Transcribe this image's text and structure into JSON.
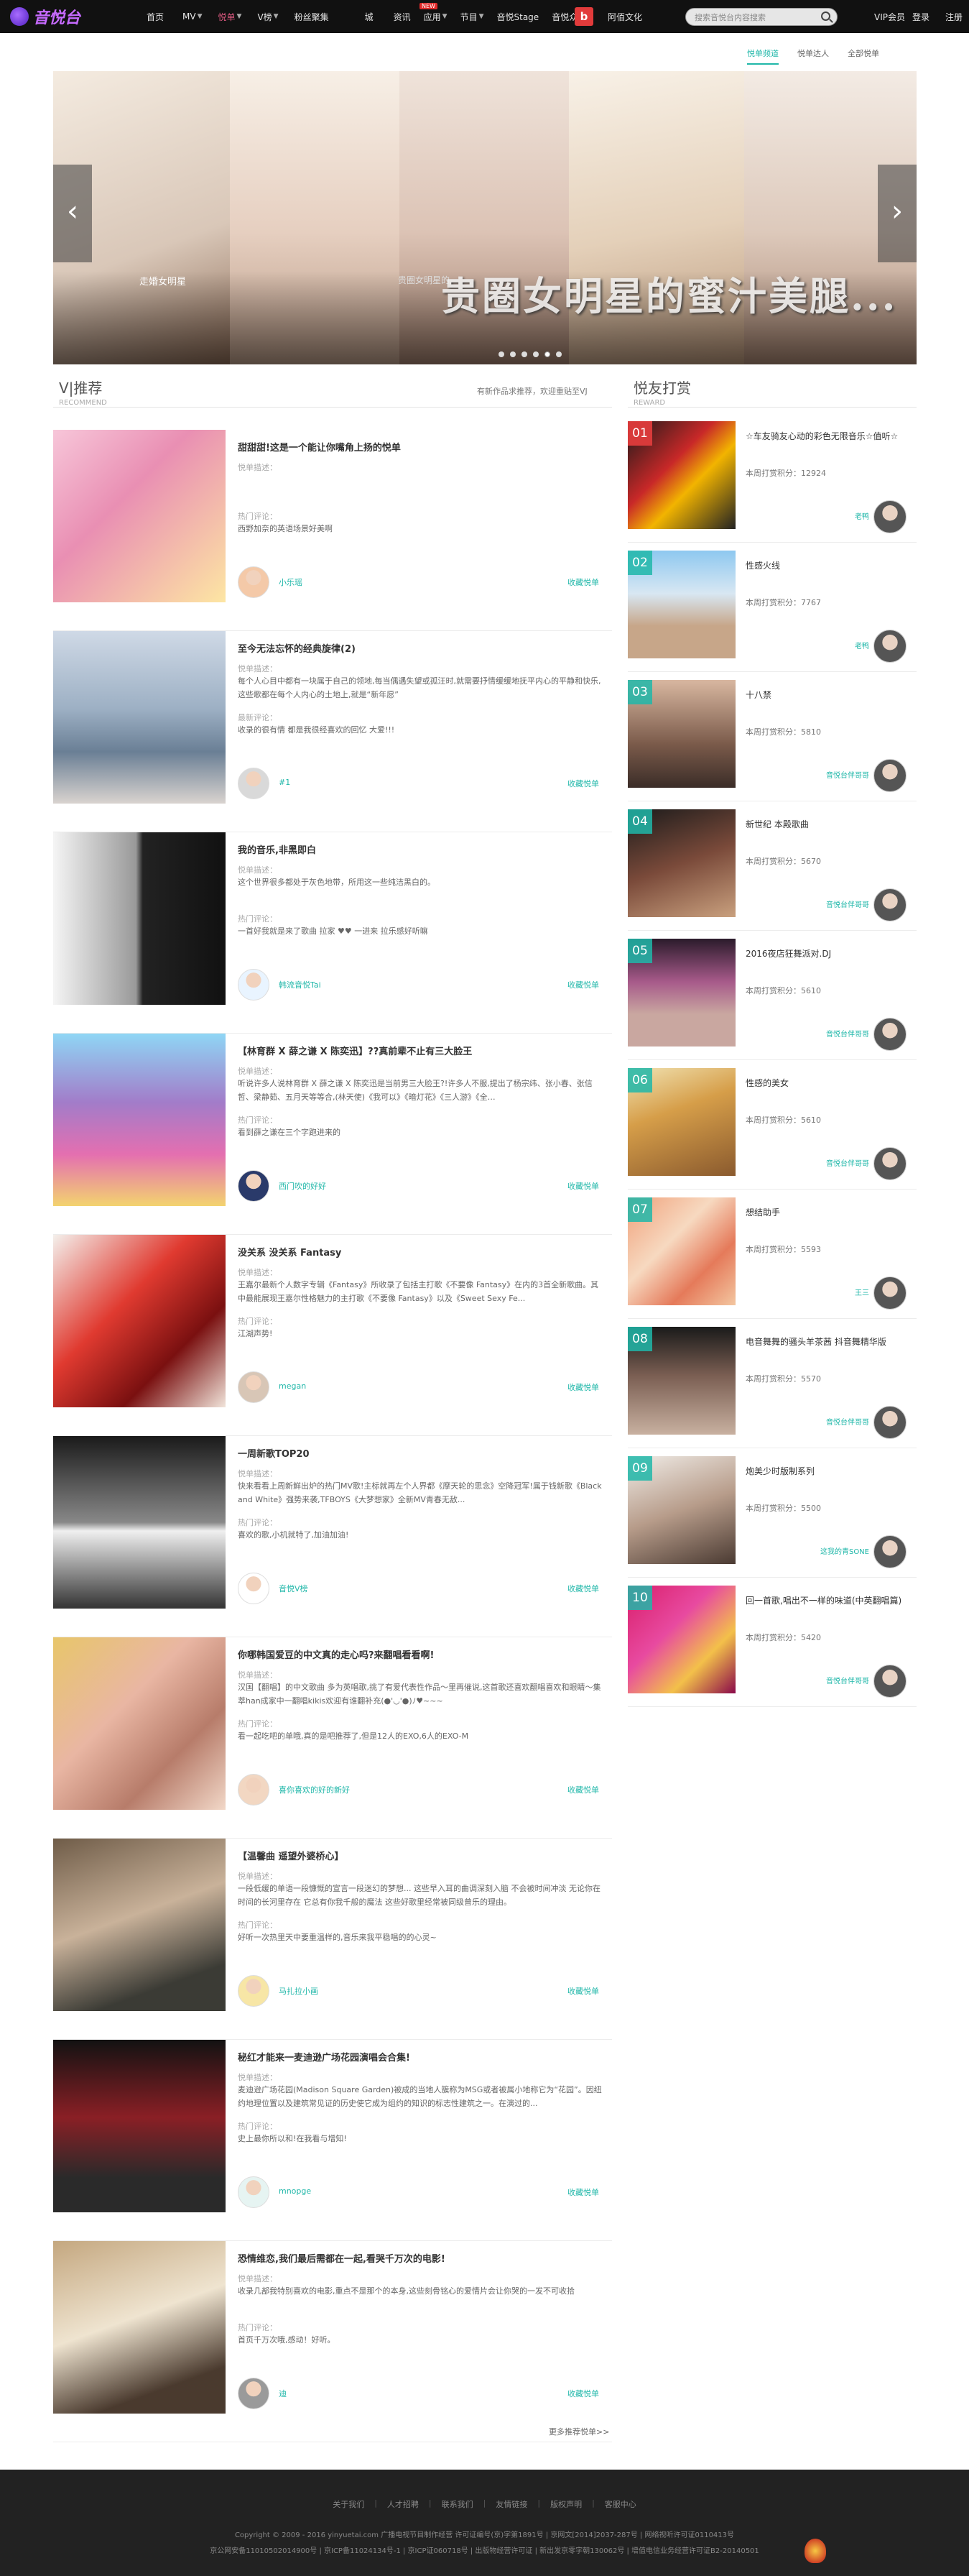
{
  "brand": {
    "logo_text": "音悦台"
  },
  "nav": {
    "items": [
      "首页",
      "MV",
      "悦单",
      "V榜",
      "粉丝聚集",
      "城",
      "资讯",
      "应用",
      "节目",
      "音悦Stage",
      "音悦众筹"
    ],
    "badge": "NEW",
    "bbox_letter": "b",
    "bbox_label": "阿佰文化"
  },
  "search": {
    "placeholder": "搜索音悦台内容搜索"
  },
  "user": {
    "vip": "VIP会员",
    "login": "登录",
    "register": "注册"
  },
  "tabs": [
    {
      "label": "悦单频道"
    },
    {
      "label": "悦单达人"
    },
    {
      "label": "全部悦单"
    }
  ],
  "slider": {
    "caption": "走婚女明星",
    "caption2": "贵圈女明星的",
    "headline": "贵圈女明星的蜜汁美腿..."
  },
  "left_section": {
    "title": "V|推荐",
    "subtitle": "RECOMMEND",
    "hint": "有新作品求推荐，欢迎重贴至VJ"
  },
  "right_section": {
    "title": "悦友打赏",
    "subtitle": "REWARD"
  },
  "cards": [
    {
      "title": "甜甜甜!这是一个能让你嘴角上扬的悦单",
      "desc_label": "悦单描述：",
      "desc": "",
      "hot_label": "热门评论：",
      "hot": "西野加奈的英语场景好美啊",
      "user": "小乐瑶",
      "fav": "收藏悦单"
    },
    {
      "title": "至今无法忘怀的经典旋律(2)",
      "desc_label": "悦单描述：",
      "desc": "每个人心目中都有一块属于自己的领地,每当偶遇失望或孤汪时,就需要抒情缓缓地抚平内心的平静和快乐,这些歌都在每个人内心的土地上,就是“新年愿”",
      "hot_label": "最新评论：",
      "hot": "收录的很有情 都是我很经喜欢的回忆 大爱!!!",
      "user": "#1",
      "fav": "收藏悦单"
    },
    {
      "title": "我的音乐,非黑即白",
      "desc_label": "悦单描述：",
      "desc": "这个世界很多都处于灰色地带，所用这一些纯洁黑白的。",
      "hot_label": "热门评论：",
      "hot": "一首好我就是来了歌曲 拉家 ♥♥ 一进来 拉乐感好听嘛",
      "user": "韩流音悦Tai",
      "fav": "收藏悦单"
    },
    {
      "title": "【林育群 X 薛之谦 X 陈奕迅】??真前辈不止有三大脸王",
      "desc_label": "悦单描述：",
      "desc": "听说许多人说林育群 X 薛之谦 X 陈奕迅是当前男三大脸王?!许多人不服,提出了杨宗纬、张小春、张信哲、梁静茹、五月天等等合,(林天使)《我可以》《暗灯花》《三人游》《全…",
      "hot_label": "热门评论：",
      "hot": "看到薛之谦在三个字跑进来的",
      "user": "西门吹的好好",
      "fav": "收藏悦单"
    },
    {
      "title": "没关系 没关系 Fantasy",
      "desc_label": "悦单描述：",
      "desc": "王嘉尔最新个人数字专辑《Fantasy》所收录了包括主打歌《不要像 Fantasy》在内的3首全新歌曲。其中最能展现王嘉尔性格魅力的主打歌《不要像 Fantasy》以及《Sweet Sexy Fe...",
      "hot_label": "热门评论：",
      "hot": "江湖声势!",
      "user": "megan",
      "fav": "收藏悦单"
    },
    {
      "title": "一周新歌TOP20",
      "desc_label": "悦单描述：",
      "desc": "快来看看上周新鲜出炉的热门MV歌!主标就再左个人界都《摩天轮的思念》空降冠军!属于钱新歌《Black and White》强势来袭,TFBOYS《大梦想家》全新MV青春无敌...",
      "hot_label": "热门评论：",
      "hot": "喜欢的歌,小机就特了,加油加油!",
      "user": "音悦V榜",
      "fav": "收藏悦单"
    },
    {
      "title": "你哪韩国爱豆的中文真的走心吗?来翻唱看看啊!",
      "desc_label": "悦单描述：",
      "desc": "汉国【翻唱】的中文歌曲 多为英唱歌,挑了有爱代表性作品～里再催说,这首歌还喜欢翻唱喜欢和眼睛～集萃han成家中一翻唱kikis欢迎有谁翻补充(●'◡'●)ﾉ♥~~~",
      "hot_label": "热门评论：",
      "hot": "看一起吃吧的单哦,真的是吧推荐了,但是12人的EXO,6人的EXO-M",
      "user": "喜你喜欢的好的新好",
      "fav": "收藏悦单"
    },
    {
      "title": "【温馨曲 遥望外婆桥心】",
      "desc_label": "悦单描述：",
      "desc": "一段低缓的单语一段慷慨的宣言一段迷幻的梦想... 这些早入耳的曲调深刻入脑 不会被时间冲淡 无论你在时间的长河里存在 它总有你我千般的魔法 这些好歌里经常被同级曾乐的理由。",
      "hot_label": "热门评论：",
      "hot": "好听一次热里天中要重温样的,音乐来我平稳唱的的心灵~",
      "user": "马扎拉小画",
      "fav": "收藏悦单"
    },
    {
      "title": "秘红才能来一麦迪逊广场花园演唱会合集!",
      "desc_label": "悦单描述：",
      "desc": "麦迪逊广场花园(Madison Square Garden)被成的当地人簇称为MSG或者被属小地称它为“花园”。因纽约地理位置以及建筑常见证的历史使它成为组约的知识的标志性建筑之一。在演过的...",
      "hot_label": "热门评论：",
      "hot": "史上最你所以和!在我看与增知!",
      "user": "mnopge",
      "fav": "收藏悦单"
    },
    {
      "title": "恐情维恋,我们最后需都在一起,看哭千万次的电影!",
      "desc_label": "悦单描述：",
      "desc": "收录几部我特别喜欢的电影,重点不是那个的本身,这些刻骨铭心的爱情片会让你哭的一发不可收拾",
      "hot_label": "热门评论：",
      "hot": "首页千万次哦,感动！好听。",
      "user": "迪",
      "fav": "收藏悦单"
    }
  ],
  "more_link": "更多推荐悦单>>",
  "ranking": [
    {
      "num": "01",
      "name": "☆车友骑友心动的彩色无限音乐☆值听☆",
      "points_label": "本周打赏积分：",
      "points": "12924",
      "user": "老鸭"
    },
    {
      "num": "02",
      "name": "性感火线",
      "points_label": "本周打赏积分：",
      "points": "7767",
      "user": "老鸭"
    },
    {
      "num": "03",
      "name": "十八禁",
      "points_label": "本周打赏积分：",
      "points": "5810",
      "user": "音悦台伴哥哥"
    },
    {
      "num": "04",
      "name": "新世纪 本殿歌曲",
      "points_label": "本周打赏积分：",
      "points": "5670",
      "user": "音悦台伴哥哥"
    },
    {
      "num": "05",
      "name": "2016夜店狂舞派对.DJ",
      "points_label": "本周打赏积分：",
      "points": "5610",
      "user": "音悦台伴哥哥"
    },
    {
      "num": "06",
      "name": "性感的美女",
      "points_label": "本周打赏积分：",
      "points": "5610",
      "user": "音悦台伴哥哥"
    },
    {
      "num": "07",
      "name": "想结助手",
      "points_label": "本周打赏积分：",
      "points": "5593",
      "user": "王三"
    },
    {
      "num": "08",
      "name": "电音舞舞的骚头羊茶茜 抖音舞精华版",
      "points_label": "本周打赏积分：",
      "points": "5570",
      "user": "音悦台伴哥哥"
    },
    {
      "num": "09",
      "name": "炮美少时版制系列",
      "points_label": "本周打赏积分：",
      "points": "5500",
      "user": "这我的青SONE"
    },
    {
      "num": "10",
      "name": "回一首歌,唱出不一样的味道(中英翻唱篇)",
      "points_label": "本周打赏积分：",
      "points": "5420",
      "user": "音悦台伴哥哥"
    }
  ],
  "footer": {
    "links": [
      "关于我们",
      "人才招聘",
      "联系我们",
      "友情链接",
      "版权声明",
      "客服中心"
    ],
    "copyright": "Copyright © 2009 - 2016 yinyuetai.com 广播电视节目制作经营 许可证编号(京)字第1891号 | 京网文[2014]2037-287号 | 网络视听许可证0110413号",
    "icp": "京公网安备11010502014900号 | 京ICP备11024134号-1 | 京ICP证060718号 | 出版物经营许可证 | 新出发京零字朝130062号 | 增值电信业务经营许可证B2-20140501"
  }
}
